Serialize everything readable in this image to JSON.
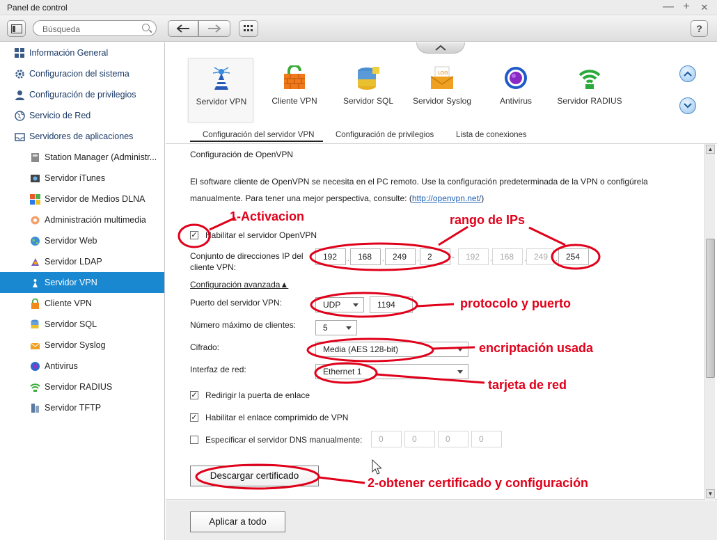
{
  "window": {
    "title": "Panel de control",
    "minimize": "—",
    "maximize": "+",
    "close": "✕"
  },
  "toolbar": {
    "search_placeholder": "Búsqueda",
    "help": "?"
  },
  "sidebar": {
    "top_items": [
      {
        "label": "Información General"
      },
      {
        "label": "Configuracion del sistema"
      },
      {
        "label": "Configuración de privilegios"
      },
      {
        "label": "Servicio de Red"
      },
      {
        "label": "Servidores de aplicaciones"
      }
    ],
    "sub_items": [
      {
        "label": "Station Manager (Administr..."
      },
      {
        "label": "Servidor iTunes"
      },
      {
        "label": "Servidor de Medios DLNA"
      },
      {
        "label": "Administración multimedia"
      },
      {
        "label": "Servidor Web"
      },
      {
        "label": "Servidor LDAP"
      },
      {
        "label": "Servidor VPN"
      },
      {
        "label": "Cliente VPN"
      },
      {
        "label": "Servidor SQL"
      },
      {
        "label": "Servidor Syslog"
      },
      {
        "label": "Antivirus"
      },
      {
        "label": "Servidor RADIUS"
      },
      {
        "label": "Servidor TFTP"
      }
    ],
    "active": "Servidor VPN"
  },
  "apps": [
    {
      "label": "Servidor VPN"
    },
    {
      "label": "Cliente VPN"
    },
    {
      "label": "Servidor SQL"
    },
    {
      "label": "Servidor Syslog"
    },
    {
      "label": "Antivirus"
    },
    {
      "label": "Servidor RADIUS"
    }
  ],
  "tabs": [
    {
      "label": "Configuración del servidor VPN"
    },
    {
      "label": "Configuración de privilegios"
    },
    {
      "label": "Lista de conexiones"
    }
  ],
  "form": {
    "section_title": "Configuración de OpenVPN",
    "desc_line1": "El software cliente de OpenVPN se necesita en el PC remoto. Use la configuración predeterminada de la VPN o configúrela",
    "desc_line2_pre": "manualmente. Para tener una mejor perspectiva, consulte: (",
    "desc_link": "http://openvpn.net/",
    "desc_line2_post": ")",
    "enable_label": "Habilitar el servidor OpenVPN",
    "enable_checked": true,
    "ip_pool_label_1": "Conjunto de direcciones IP del",
    "ip_pool_label_2": "cliente VPN:",
    "ip_start": [
      "192",
      "168",
      "249",
      "2"
    ],
    "ip_end": [
      "192",
      "168",
      "249",
      "254"
    ],
    "dash": "-",
    "advanced": "Configuración avanzada▲",
    "port_label": "Puerto del servidor VPN:",
    "protocol": "UDP",
    "port": "1194",
    "max_clients_label": "Número máximo de clientes:",
    "max_clients": "5",
    "cipher_label": "Cifrado:",
    "cipher": "Media (AES 128-bit)",
    "iface_label": "Interfaz de red:",
    "iface": "Ethernet 1",
    "redirect_label": "Redirigir la puerta de enlace",
    "redirect_checked": true,
    "compress_label": "Habilitar el enlace comprimido de VPN",
    "compress_checked": true,
    "dns_label": "Especificar el servidor DNS manualmente:",
    "dns_checked": false,
    "dns": [
      "0",
      "0",
      "0",
      "0"
    ],
    "download_button": "Descargar certificado"
  },
  "footer": {
    "apply_button": "Aplicar a todo"
  },
  "annotations": {
    "activation": "1-Activacion",
    "ip_range": "rango de IPs",
    "protocol_port": "protocolo y puerto",
    "encryption": "encriptación usada",
    "nic": "tarjeta de red",
    "certificate": "2-obtener certificado y configuración"
  },
  "colors": {
    "accent": "#1a88d0",
    "annotation": "#e0001a",
    "link": "#1a5fb4"
  }
}
